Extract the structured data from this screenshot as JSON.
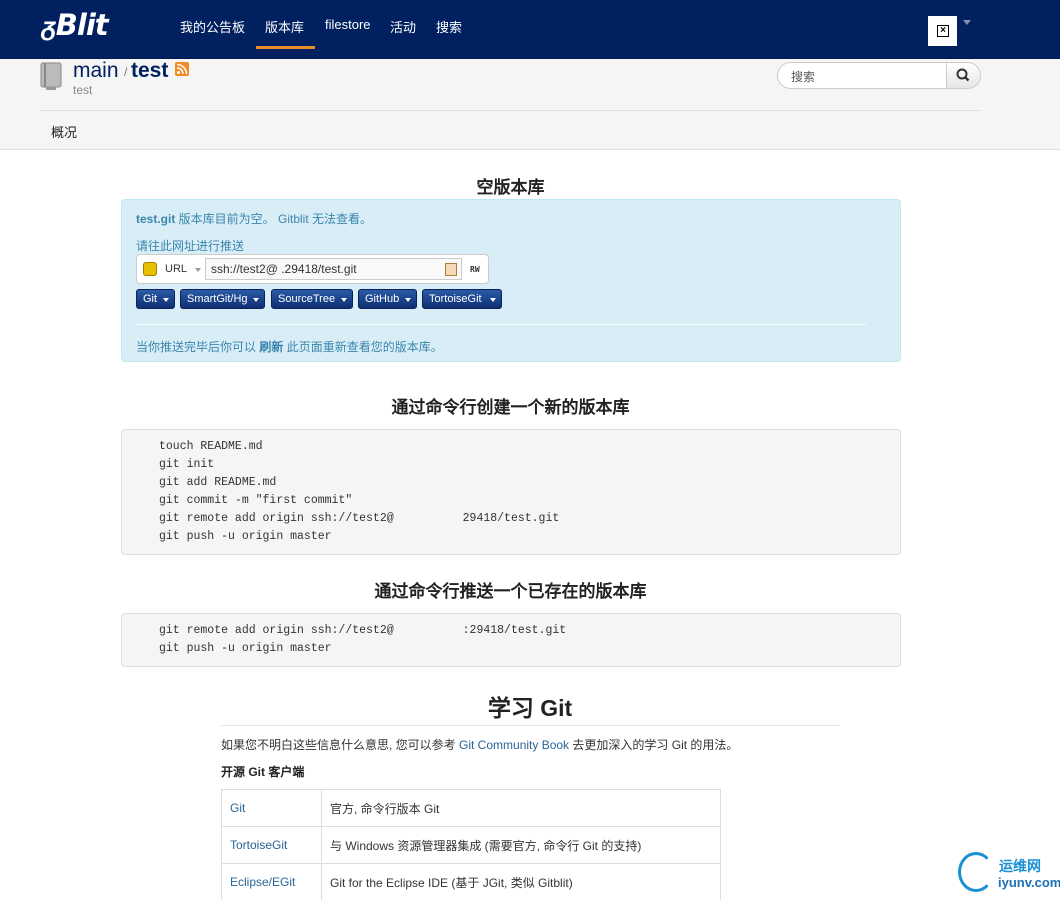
{
  "navbar": {
    "brand": "Blit",
    "brand_glyph": "ᵹ",
    "items": [
      {
        "label": "我的公告板"
      },
      {
        "label": "版本库"
      },
      {
        "label": "filestore"
      },
      {
        "label": "活动"
      },
      {
        "label": "搜索"
      }
    ],
    "active_item": "版本库",
    "user_icon": "broken-image-icon",
    "accent_color": "#e98b2a",
    "bg_color": "#002060"
  },
  "repo": {
    "project": "main",
    "separator": "/",
    "name": "test",
    "description": "test",
    "search_placeholder": "搜索",
    "tab": "概况"
  },
  "empty": {
    "heading": "空版本库",
    "repo_git": "test.git",
    "line1_rest": " 版本库目前为空。 Gitblit 无法查看。",
    "push_hint": "请往此网址进行推送",
    "url_label": "URL",
    "url_value": "ssh://test2@         .29418/test.git",
    "permission": "RW",
    "client_buttons": [
      "Git",
      "SmartGit/Hg",
      "SourceTree",
      "GitHub",
      "TortoiseGit"
    ],
    "refresh_pre": "当你推送完毕后你可以 ",
    "refresh_link": "刷新",
    "refresh_post": " 此页面重新查看您的版本库。"
  },
  "create": {
    "heading": "通过命令行创建一个新的版本库",
    "code": "touch README.md\ngit init\ngit add README.md\ngit commit -m \"first commit\"\ngit remote add origin ssh://test2@          29418/test.git\ngit push -u origin master"
  },
  "push_existing": {
    "heading": "通过命令行推送一个已存在的版本库",
    "code": "git remote add origin ssh://test2@          :29418/test.git\ngit push -u origin master"
  },
  "learn": {
    "heading": "学习 Git",
    "text_pre": "如果您不明白这些信息什么意思, 您可以参考 ",
    "text_link": "Git Community Book",
    "text_post": " 去更加深入的学习 Git 的用法。",
    "subheading": "开源 Git 客户端",
    "clients": [
      {
        "name": "Git",
        "desc": "官方, 命令行版本 Git"
      },
      {
        "name": "TortoiseGit",
        "desc": "与 Windows 资源管理器集成 (需要官方, 命令行 Git 的支持)"
      },
      {
        "name": "Eclipse/EGit",
        "desc": "Git for the Eclipse IDE (基于 JGit, 类似 Gitblit)"
      }
    ]
  },
  "watermark": {
    "line1": "运维网",
    "line2": "iyunv.com"
  }
}
